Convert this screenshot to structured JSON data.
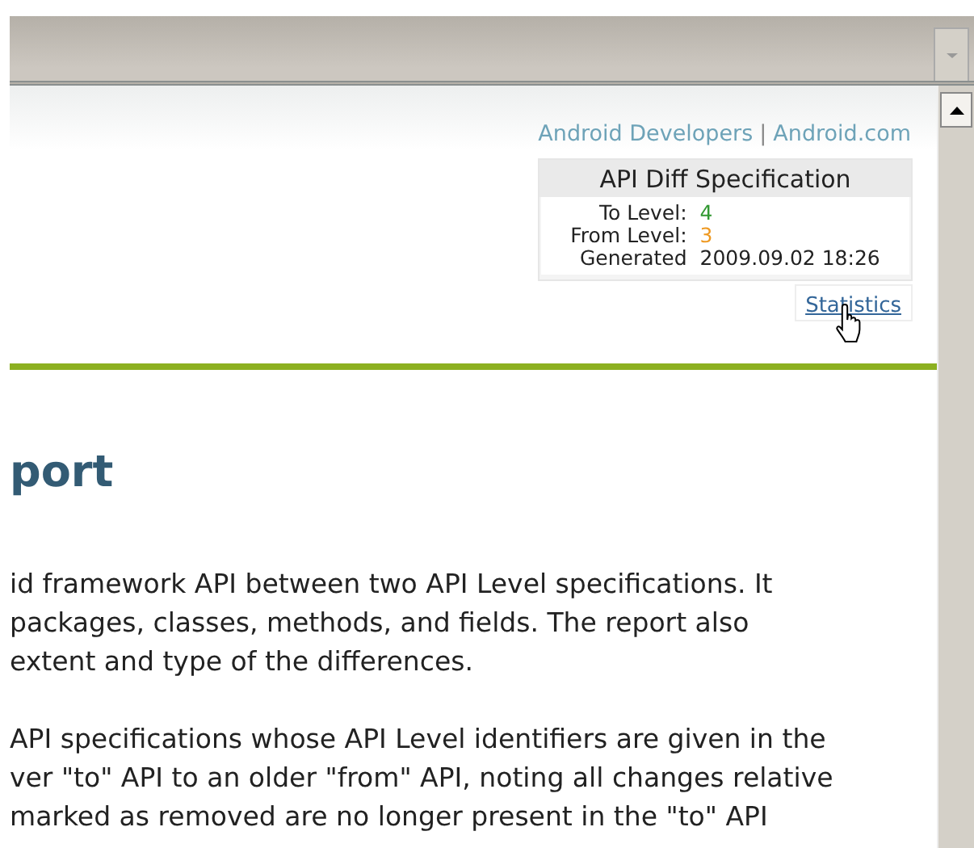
{
  "header_links": [
    {
      "label": "Android Developers"
    },
    {
      "label": "Android.com"
    }
  ],
  "link_separator": "|",
  "spec_box": {
    "title": "API Diff Specification",
    "rows": [
      {
        "label": "To Level:",
        "value": "4",
        "color": "#339933"
      },
      {
        "label": "From Level:",
        "value": "3",
        "color": "#ee9922"
      },
      {
        "label": "Generated",
        "value": "2009.09.02 18:26"
      }
    ]
  },
  "statistics_link": "Statistics",
  "heading": "port",
  "paragraphs": [
    {
      "lines": [
        "id framework API between two API Level specifications. It",
        "packages, classes, methods, and fields. The report also",
        "extent and type of the differences."
      ]
    },
    {
      "lines": [
        "API specifications whose API Level identifiers are given in the",
        "ver \"to\" API to an older \"from\" API, noting all changes relative",
        "marked as removed are no longer present in the \"to\" API"
      ]
    }
  ]
}
